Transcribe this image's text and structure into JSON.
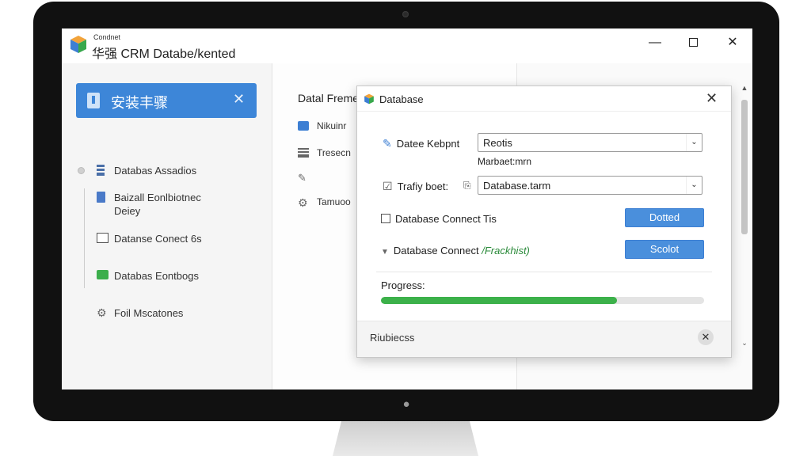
{
  "app": {
    "small_label": "Condnet",
    "title": "华强 CRM Databe/kented",
    "window_controls": {
      "minimize": "—",
      "close": "✕"
    }
  },
  "left_panel": {
    "banner": {
      "label": "安装丰骤",
      "close": "✕"
    },
    "items": [
      {
        "label": "Databas Assadios",
        "icon": "database-icon"
      },
      {
        "label": "Baizall Eonlbiotnec",
        "label2": "Deiey",
        "icon": "document-icon"
      },
      {
        "label": "Datanse Conect 6s",
        "icon": "window-icon"
      },
      {
        "label": "Databas Eontbogs",
        "icon": "chat-icon"
      },
      {
        "label": "Foil Mscatones",
        "icon": "gear-icon"
      }
    ]
  },
  "middle_panel": {
    "heading": "Datal Freme",
    "items": [
      {
        "label": "Nikuinr",
        "icon": "folder-icon"
      },
      {
        "label": "Tresecn",
        "icon": "database-icon"
      },
      {
        "label": "",
        "icon": "pen-icon"
      },
      {
        "label": "Tamuoo",
        "icon": "gear-icon"
      }
    ]
  },
  "dialog": {
    "title": "Database",
    "close": "✕",
    "field1": {
      "label": "Datee Kebpnt",
      "value": "Reotis"
    },
    "sub_label": "Marbaet:mrn",
    "field2": {
      "label": "Trafiy boet:",
      "value": "Database.tarm"
    },
    "checkbox": {
      "label": "Database Connect Tis",
      "button": "Dotted"
    },
    "expand": {
      "label": "Database Connect",
      "status": "/Frackhist)",
      "button": "Scolot"
    },
    "progress": {
      "label": "Progress:",
      "value": 0.73
    },
    "footer": {
      "label": "Riubiecss",
      "close": "✕"
    }
  },
  "colors": {
    "accent": "#3d86d8",
    "button": "#4a8fdc",
    "progress": "#3cb14a"
  }
}
